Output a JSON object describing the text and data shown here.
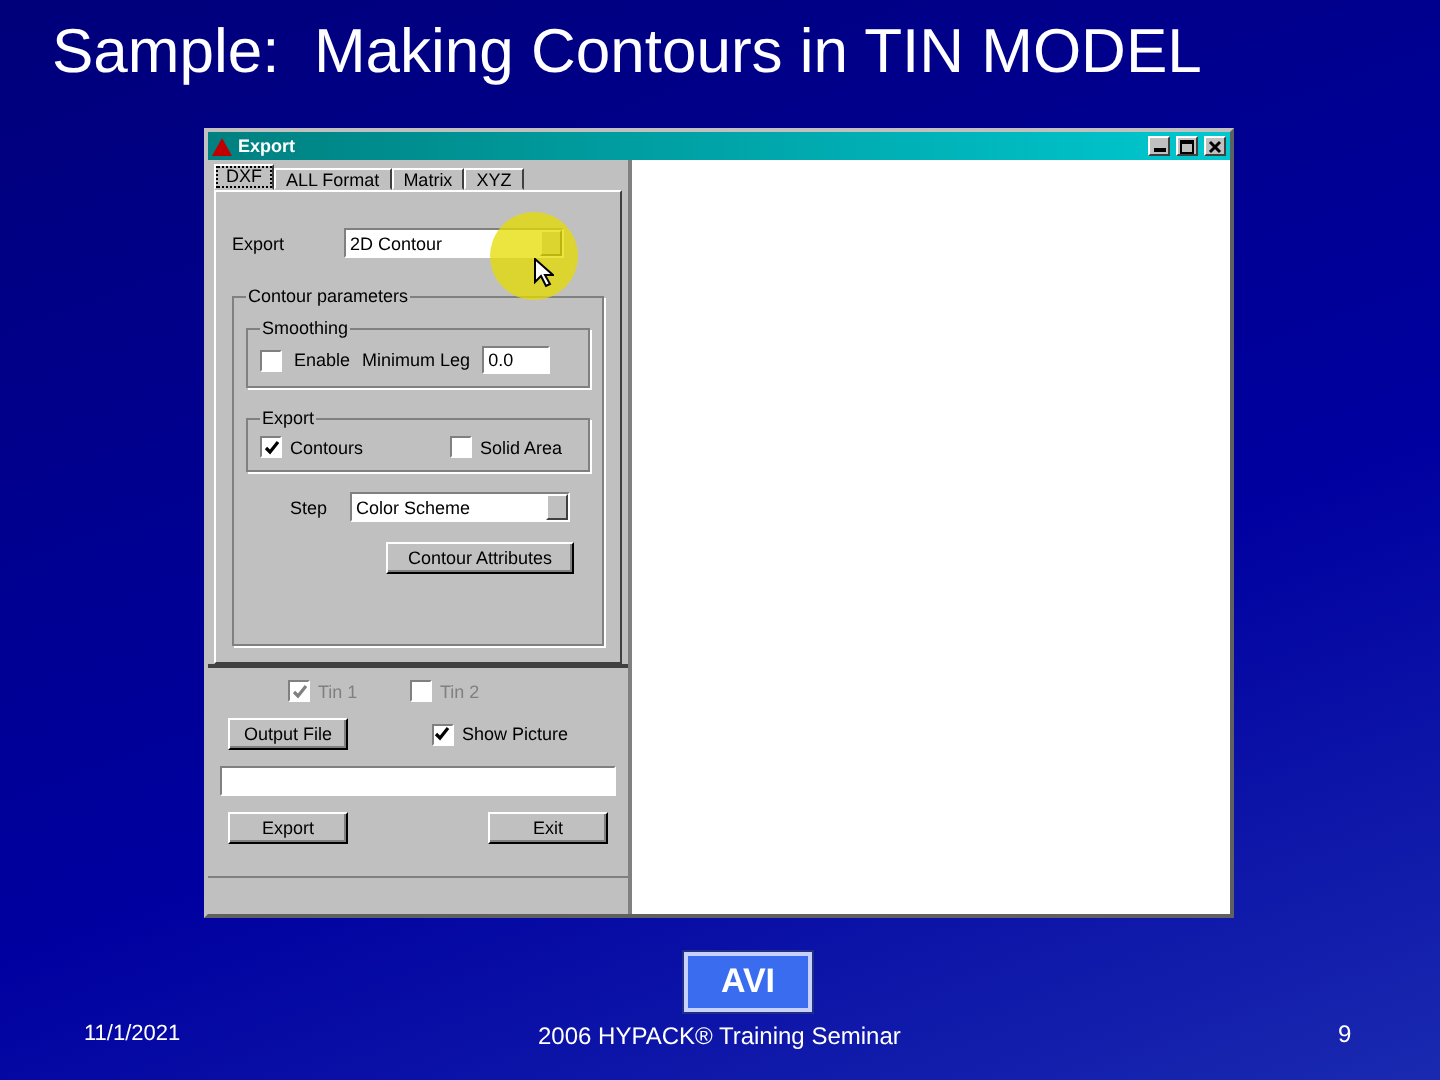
{
  "slide": {
    "title": "Sample:  Making Contours in TIN MODEL",
    "badge": "AVI",
    "date": "11/1/2021",
    "footer": "2006 HYPACK® Training Seminar",
    "page_number": "9"
  },
  "window": {
    "title": "Export",
    "tabs": [
      {
        "label": "DXF",
        "selected": true
      },
      {
        "label": "ALL Format",
        "selected": false
      },
      {
        "label": "Matrix",
        "selected": false
      },
      {
        "label": "XYZ",
        "selected": false
      }
    ],
    "export_label": "Export",
    "export_format": "2D Contour",
    "contour_group": "Contour parameters",
    "smoothing": {
      "title": "Smoothing",
      "enable": {
        "label": "Enable",
        "checked": false
      },
      "min_leg_label": "Minimum Leg",
      "min_leg_value": "0.0"
    },
    "export_group": {
      "title": "Export",
      "options": [
        {
          "label": "Contours",
          "checked": true
        },
        {
          "label": "Solid Area",
          "checked": false
        }
      ]
    },
    "step_label": "Step",
    "step_value": "Color Scheme",
    "attributes_button": "Contour Attributes",
    "tins": [
      {
        "label": "Tin 1",
        "checked": true,
        "disabled": true
      },
      {
        "label": "Tin 2",
        "checked": false,
        "disabled": true
      }
    ],
    "output_button": "Output File",
    "show_picture": {
      "label": "Show Picture",
      "checked": true
    },
    "buttons": [
      "Export",
      "Exit"
    ]
  }
}
